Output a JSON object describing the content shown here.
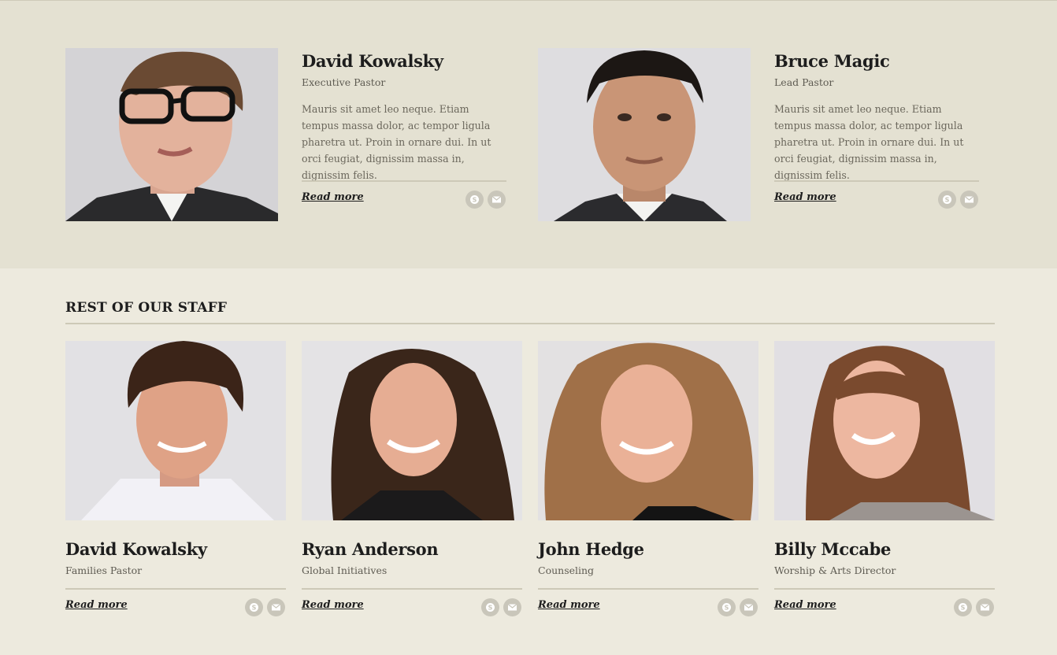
{
  "featured": [
    {
      "name": "David Kowalsky",
      "role": "Executive Pastor",
      "bio": "Mauris sit amet leo neque. Etiam tempus massa dolor, ac tempor ligula pharetra ut. Proin in ornare dui. In ut orci feugiat, dignissim massa in, dignissim felis.",
      "read_more": "Read more",
      "icons": [
        "skype-icon",
        "mail-icon"
      ]
    },
    {
      "name": "Bruce Magic",
      "role": "Lead Pastor",
      "bio": "Mauris sit amet leo neque. Etiam tempus massa dolor, ac tempor ligula pharetra ut. Proin in ornare dui. In ut orci feugiat, dignissim massa in, dignissim felis.",
      "read_more": "Read more",
      "icons": [
        "skype-icon",
        "mail-icon"
      ]
    }
  ],
  "staff_section": {
    "title": "REST OF OUR STAFF",
    "members": [
      {
        "name": "David Kowalsky",
        "role": "Families Pastor",
        "read_more": "Read more"
      },
      {
        "name": "Ryan Anderson",
        "role": "Global Initiatives",
        "read_more": "Read more"
      },
      {
        "name": "John Hedge",
        "role": "Counseling",
        "read_more": "Read more"
      },
      {
        "name": "Billy Mccabe",
        "role": "Worship & Arts Director",
        "read_more": "Read more"
      }
    ]
  },
  "colors": {
    "featured_bg": "#e4e1d2",
    "page_bg": "#edeade",
    "rule": "#cdc9b7",
    "icon_bg": "#c9c6ba"
  }
}
